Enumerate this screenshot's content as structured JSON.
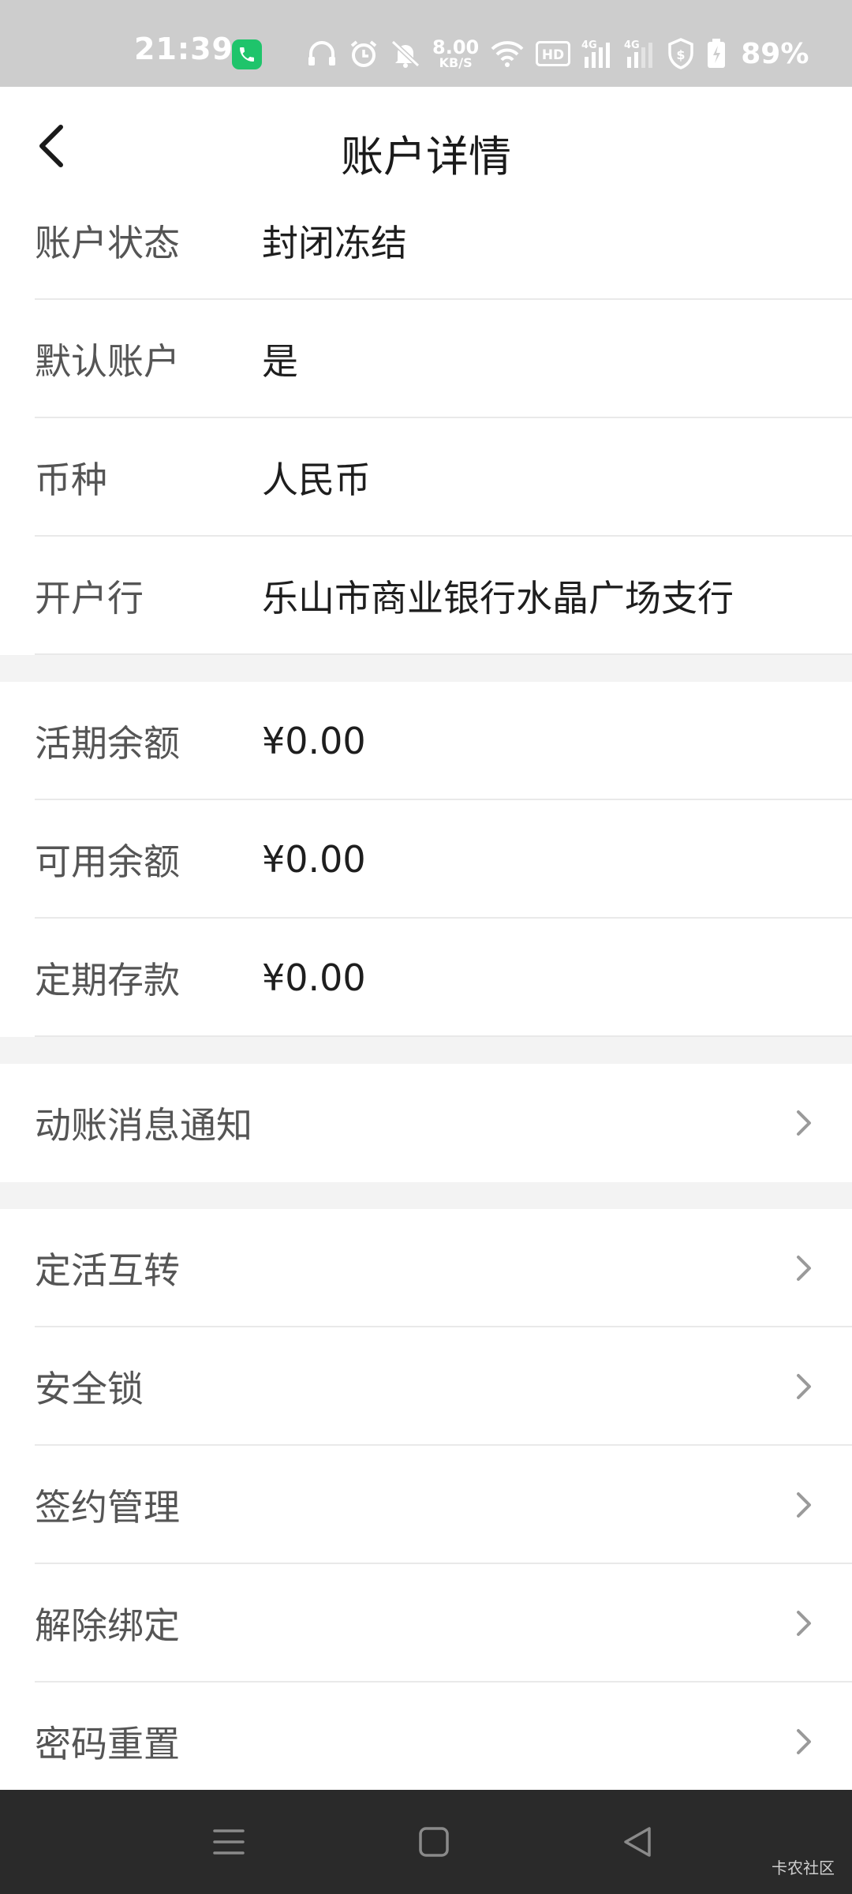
{
  "status_bar": {
    "time": "21:39",
    "net_speed_value": "8.00",
    "net_speed_unit": "KB/S",
    "hd_label": "HD",
    "sim1_label": "4G",
    "sim2_label": "4G",
    "battery_percent": "89%"
  },
  "header": {
    "title": "账户详情"
  },
  "account_info": [
    {
      "label": "账户状态",
      "value": "封闭冻结"
    },
    {
      "label": "默认账户",
      "value": "是"
    },
    {
      "label": "币种",
      "value": "人民币"
    },
    {
      "label": "开户行",
      "value": "乐山市商业银行水晶广场支行"
    }
  ],
  "balances": [
    {
      "label": "活期余额",
      "value": "¥0.00"
    },
    {
      "label": "可用余额",
      "value": "¥0.00"
    },
    {
      "label": "定期存款",
      "value": "¥0.00"
    }
  ],
  "notice": {
    "label": "动账消息通知"
  },
  "actions": [
    {
      "label": "定活互转"
    },
    {
      "label": "安全锁"
    },
    {
      "label": "签约管理"
    },
    {
      "label": "解除绑定"
    },
    {
      "label": "密码重置"
    }
  ],
  "watermark": "卡农社区",
  "colors": {
    "call_badge": "#1fc46b",
    "status_bar": "#cdcdcd",
    "nav_bar": "#2a2a2a",
    "section_gap": "#f3f3f3"
  }
}
